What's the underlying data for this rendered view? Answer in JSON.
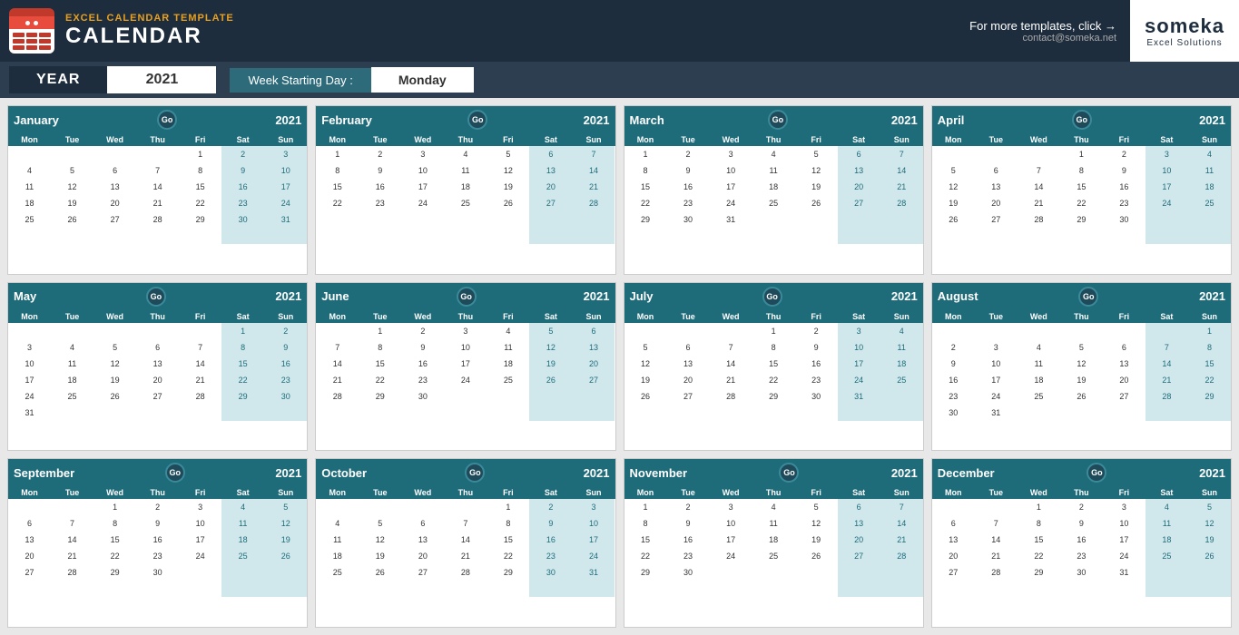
{
  "header": {
    "subtitle": "EXCEL CALENDAR TEMPLATE",
    "title": "CALENDAR",
    "for_more": "For more templates, click",
    "arrow": "→",
    "contact": "contact@someka.net",
    "logo_name": "someka",
    "logo_sub": "Excel Solutions"
  },
  "year_row": {
    "year_label": "YEAR",
    "year_value": "2021",
    "week_label": "Week Starting Day :",
    "week_value": "Monday"
  },
  "months": [
    {
      "name": "January",
      "year": "2021",
      "days": [
        "Mon",
        "Tue",
        "Wed",
        "Thu",
        "Fri",
        "Sat",
        "Sun"
      ],
      "rows": [
        [
          "",
          "",
          "",
          "",
          "1",
          "2",
          "3"
        ],
        [
          "4",
          "5",
          "6",
          "7",
          "8",
          "9",
          "10"
        ],
        [
          "11",
          "12",
          "13",
          "14",
          "15",
          "16",
          "17"
        ],
        [
          "18",
          "19",
          "20",
          "21",
          "22",
          "23",
          "24"
        ],
        [
          "25",
          "26",
          "27",
          "28",
          "29",
          "30",
          "31"
        ],
        [
          "",
          "",
          "",
          "",
          "",
          "",
          ""
        ]
      ]
    },
    {
      "name": "February",
      "year": "2021",
      "days": [
        "Mon",
        "Tue",
        "Wed",
        "Thu",
        "Fri",
        "Sat",
        "Sun"
      ],
      "rows": [
        [
          "1",
          "2",
          "3",
          "4",
          "5",
          "6",
          "7"
        ],
        [
          "8",
          "9",
          "10",
          "11",
          "12",
          "13",
          "14"
        ],
        [
          "15",
          "16",
          "17",
          "18",
          "19",
          "20",
          "21"
        ],
        [
          "22",
          "23",
          "24",
          "25",
          "26",
          "27",
          "28"
        ],
        [
          "",
          "",
          "",
          "",
          "",
          "",
          ""
        ],
        [
          "",
          "",
          "",
          "",
          "",
          "",
          ""
        ]
      ]
    },
    {
      "name": "March",
      "year": "2021",
      "days": [
        "Mon",
        "Tue",
        "Wed",
        "Thu",
        "Fri",
        "Sat",
        "Sun"
      ],
      "rows": [
        [
          "1",
          "2",
          "3",
          "4",
          "5",
          "6",
          "7"
        ],
        [
          "8",
          "9",
          "10",
          "11",
          "12",
          "13",
          "14"
        ],
        [
          "15",
          "16",
          "17",
          "18",
          "19",
          "20",
          "21"
        ],
        [
          "22",
          "23",
          "24",
          "25",
          "26",
          "27",
          "28"
        ],
        [
          "29",
          "30",
          "31",
          "",
          "",
          "",
          ""
        ],
        [
          "",
          "",
          "",
          "",
          "",
          "",
          ""
        ]
      ]
    },
    {
      "name": "April",
      "year": "2021",
      "days": [
        "Mon",
        "Tue",
        "Wed",
        "Thu",
        "Fri",
        "Sat",
        "Sun"
      ],
      "rows": [
        [
          "",
          "",
          "",
          "1",
          "2",
          "3",
          "4"
        ],
        [
          "5",
          "6",
          "7",
          "8",
          "9",
          "10",
          "11"
        ],
        [
          "12",
          "13",
          "14",
          "15",
          "16",
          "17",
          "18"
        ],
        [
          "19",
          "20",
          "21",
          "22",
          "23",
          "24",
          "25"
        ],
        [
          "26",
          "27",
          "28",
          "29",
          "30",
          "",
          ""
        ],
        [
          "",
          "",
          "",
          "",
          "",
          "",
          ""
        ]
      ]
    },
    {
      "name": "May",
      "year": "2021",
      "days": [
        "Mon",
        "Tue",
        "Wed",
        "Thu",
        "Fri",
        "Sat",
        "Sun"
      ],
      "rows": [
        [
          "",
          "",
          "",
          "",
          "",
          "1",
          "2"
        ],
        [
          "3",
          "4",
          "5",
          "6",
          "7",
          "8",
          "9"
        ],
        [
          "10",
          "11",
          "12",
          "13",
          "14",
          "15",
          "16"
        ],
        [
          "17",
          "18",
          "19",
          "20",
          "21",
          "22",
          "23"
        ],
        [
          "24",
          "25",
          "26",
          "27",
          "28",
          "29",
          "30"
        ],
        [
          "31",
          "",
          "",
          "",
          "",
          "",
          ""
        ]
      ]
    },
    {
      "name": "June",
      "year": "2021",
      "days": [
        "Mon",
        "Tue",
        "Wed",
        "Thu",
        "Fri",
        "Sat",
        "Sun"
      ],
      "rows": [
        [
          "",
          "1",
          "2",
          "3",
          "4",
          "5",
          "6"
        ],
        [
          "7",
          "8",
          "9",
          "10",
          "11",
          "12",
          "13"
        ],
        [
          "14",
          "15",
          "16",
          "17",
          "18",
          "19",
          "20"
        ],
        [
          "21",
          "22",
          "23",
          "24",
          "25",
          "26",
          "27"
        ],
        [
          "28",
          "29",
          "30",
          "",
          "",
          "",
          ""
        ],
        [
          "",
          "",
          "",
          "",
          "",
          "",
          ""
        ]
      ]
    },
    {
      "name": "July",
      "year": "2021",
      "days": [
        "Mon",
        "Tue",
        "Wed",
        "Thu",
        "Fri",
        "Sat",
        "Sun"
      ],
      "rows": [
        [
          "",
          "",
          "",
          "1",
          "2",
          "3",
          "4"
        ],
        [
          "5",
          "6",
          "7",
          "8",
          "9",
          "10",
          "11"
        ],
        [
          "12",
          "13",
          "14",
          "15",
          "16",
          "17",
          "18"
        ],
        [
          "19",
          "20",
          "21",
          "22",
          "23",
          "24",
          "25"
        ],
        [
          "26",
          "27",
          "28",
          "29",
          "30",
          "31",
          ""
        ],
        [
          "",
          "",
          "",
          "",
          "",
          "",
          ""
        ]
      ]
    },
    {
      "name": "August",
      "year": "2021",
      "days": [
        "Mon",
        "Tue",
        "Wed",
        "Thu",
        "Fri",
        "Sat",
        "Sun"
      ],
      "rows": [
        [
          "",
          "",
          "",
          "",
          "",
          "",
          "1"
        ],
        [
          "2",
          "3",
          "4",
          "5",
          "6",
          "7",
          "8"
        ],
        [
          "9",
          "10",
          "11",
          "12",
          "13",
          "14",
          "15"
        ],
        [
          "16",
          "17",
          "18",
          "19",
          "20",
          "21",
          "22"
        ],
        [
          "23",
          "24",
          "25",
          "26",
          "27",
          "28",
          "29"
        ],
        [
          "30",
          "31",
          "",
          "",
          "",
          "",
          ""
        ]
      ]
    },
    {
      "name": "September",
      "year": "2021",
      "days": [
        "Mon",
        "Tue",
        "Wed",
        "Thu",
        "Fri",
        "Sat",
        "Sun"
      ],
      "rows": [
        [
          "",
          "",
          "1",
          "2",
          "3",
          "4",
          "5"
        ],
        [
          "6",
          "7",
          "8",
          "9",
          "10",
          "11",
          "12"
        ],
        [
          "13",
          "14",
          "15",
          "16",
          "17",
          "18",
          "19"
        ],
        [
          "20",
          "21",
          "22",
          "23",
          "24",
          "25",
          "26"
        ],
        [
          "27",
          "28",
          "29",
          "30",
          "",
          "",
          ""
        ],
        [
          "",
          "",
          "",
          "",
          "",
          "",
          ""
        ]
      ]
    },
    {
      "name": "October",
      "year": "2021",
      "days": [
        "Mon",
        "Tue",
        "Wed",
        "Thu",
        "Fri",
        "Sat",
        "Sun"
      ],
      "rows": [
        [
          "",
          "",
          "",
          "",
          "1",
          "2",
          "3"
        ],
        [
          "4",
          "5",
          "6",
          "7",
          "8",
          "9",
          "10"
        ],
        [
          "11",
          "12",
          "13",
          "14",
          "15",
          "16",
          "17"
        ],
        [
          "18",
          "19",
          "20",
          "21",
          "22",
          "23",
          "24"
        ],
        [
          "25",
          "26",
          "27",
          "28",
          "29",
          "30",
          "31"
        ],
        [
          "",
          "",
          "",
          "",
          "",
          "",
          ""
        ]
      ]
    },
    {
      "name": "November",
      "year": "2021",
      "days": [
        "Mon",
        "Tue",
        "Wed",
        "Thu",
        "Fri",
        "Sat",
        "Sun"
      ],
      "rows": [
        [
          "1",
          "2",
          "3",
          "4",
          "5",
          "6",
          "7"
        ],
        [
          "8",
          "9",
          "10",
          "11",
          "12",
          "13",
          "14"
        ],
        [
          "15",
          "16",
          "17",
          "18",
          "19",
          "20",
          "21"
        ],
        [
          "22",
          "23",
          "24",
          "25",
          "26",
          "27",
          "28"
        ],
        [
          "29",
          "30",
          "",
          "",
          "",
          "",
          ""
        ],
        [
          "",
          "",
          "",
          "",
          "",
          "",
          ""
        ]
      ]
    },
    {
      "name": "December",
      "year": "2021",
      "days": [
        "Mon",
        "Tue",
        "Wed",
        "Thu",
        "Fri",
        "Sat",
        "Sun"
      ],
      "rows": [
        [
          "",
          "",
          "1",
          "2",
          "3",
          "4",
          "5"
        ],
        [
          "6",
          "7",
          "8",
          "9",
          "10",
          "11",
          "12"
        ],
        [
          "13",
          "14",
          "15",
          "16",
          "17",
          "18",
          "19"
        ],
        [
          "20",
          "21",
          "22",
          "23",
          "24",
          "25",
          "26"
        ],
        [
          "27",
          "28",
          "29",
          "30",
          "31",
          "",
          ""
        ],
        [
          "",
          "",
          "",
          "",
          "",
          "",
          ""
        ]
      ]
    }
  ]
}
